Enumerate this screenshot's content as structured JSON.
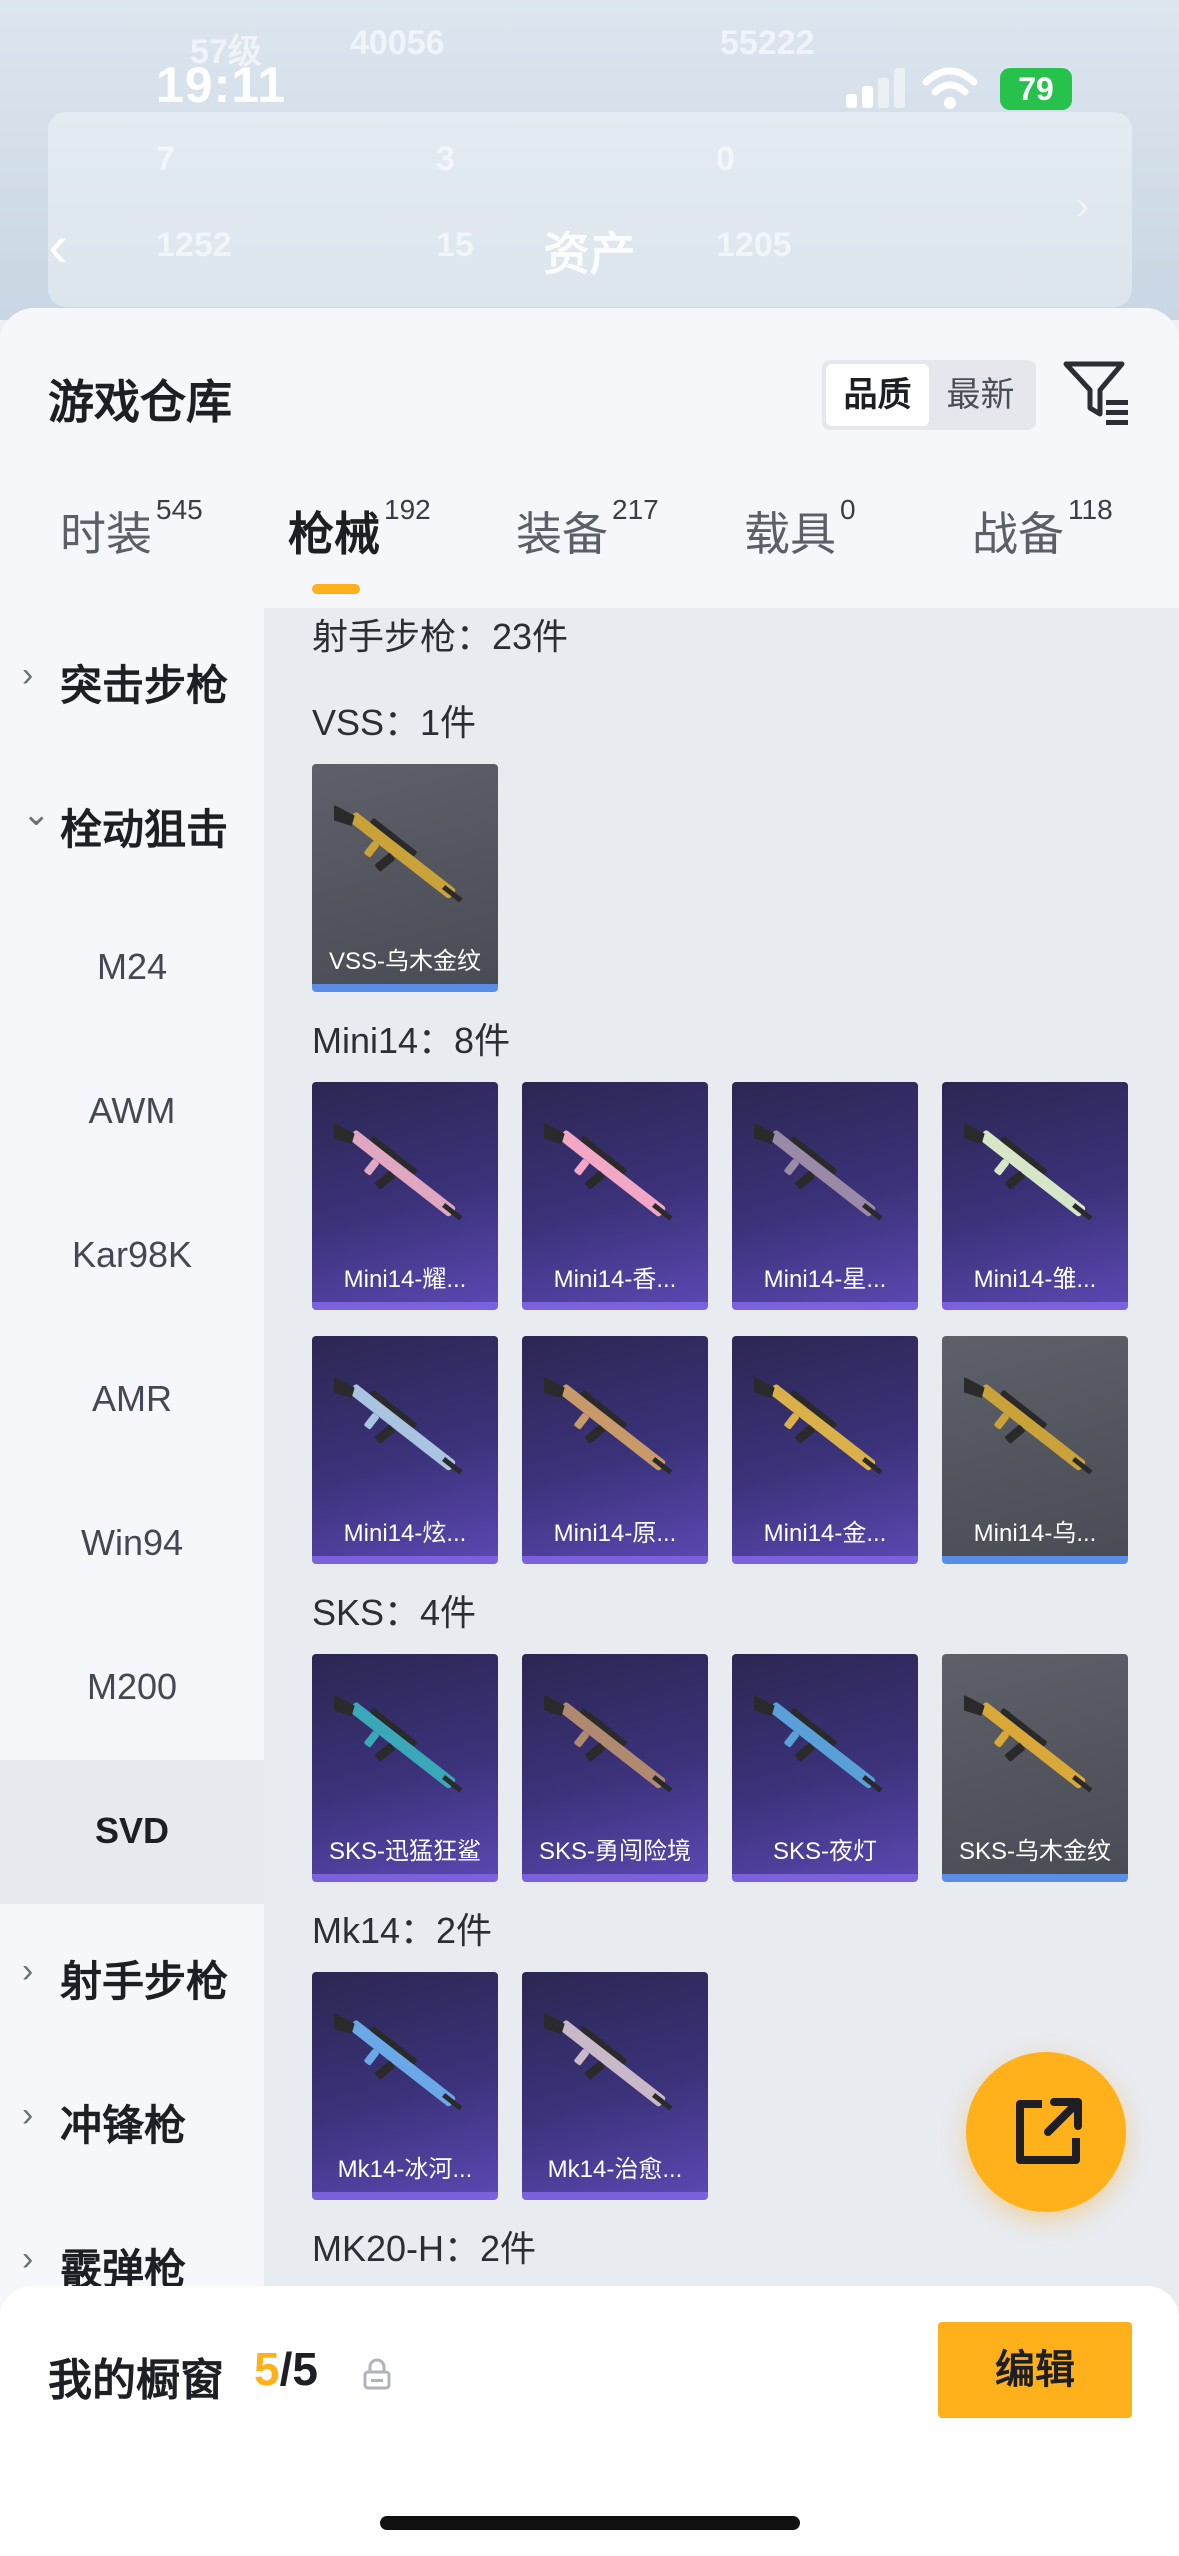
{
  "status": {
    "time": "19:11",
    "battery": "79"
  },
  "background": {
    "nav_title": "资产",
    "level": "57级",
    "views": "40056",
    "score": "55222",
    "stats": [
      "7",
      "3",
      "0",
      "1252",
      "15",
      "1205"
    ]
  },
  "header": {
    "title": "游戏仓库",
    "sort_options": [
      "品质",
      "最新"
    ],
    "active_sort": "品质"
  },
  "tabs": [
    {
      "label": "时装",
      "count": "545"
    },
    {
      "label": "枪械",
      "count": "192",
      "active": true
    },
    {
      "label": "装备",
      "count": "217"
    },
    {
      "label": "载具",
      "count": "0"
    },
    {
      "label": "战备",
      "count": "118"
    }
  ],
  "sidebar": [
    {
      "label": "突击步枪",
      "type": "category"
    },
    {
      "label": "栓动狙击",
      "type": "category",
      "expanded": true
    },
    {
      "label": "M24",
      "type": "sub"
    },
    {
      "label": "AWM",
      "type": "sub"
    },
    {
      "label": "Kar98K",
      "type": "sub"
    },
    {
      "label": "AMR",
      "type": "sub"
    },
    {
      "label": "Win94",
      "type": "sub"
    },
    {
      "label": "M200",
      "type": "sub"
    },
    {
      "label": "SVD",
      "type": "sub",
      "selected": true
    },
    {
      "label": "射手步枪",
      "type": "category"
    },
    {
      "label": "冲锋枪",
      "type": "category"
    },
    {
      "label": "霰弹枪",
      "type": "category"
    }
  ],
  "content": {
    "section_header": "射手步枪：23件",
    "groups": [
      {
        "title": "VSS：1件",
        "items": [
          {
            "name": "VSS-乌木金纹",
            "rarity": "dark",
            "gun_color": "#c9a23a"
          }
        ]
      },
      {
        "title": "Mini14：8件",
        "items": [
          {
            "name": "Mini14-耀...",
            "rarity": "purple",
            "gun_color": "#e0a7c0"
          },
          {
            "name": "Mini14-香...",
            "rarity": "purple",
            "gun_color": "#f2a7c4"
          },
          {
            "name": "Mini14-星...",
            "rarity": "purple",
            "gun_color": "#9a8aa8"
          },
          {
            "name": "Mini14-雏...",
            "rarity": "purple",
            "gun_color": "#d8e6c8"
          },
          {
            "name": "Mini14-炫...",
            "rarity": "purple",
            "gun_color": "#a9c4e0"
          },
          {
            "name": "Mini14-原...",
            "rarity": "purple",
            "gun_color": "#c89a6a"
          },
          {
            "name": "Mini14-金...",
            "rarity": "purple",
            "gun_color": "#d9b04a"
          },
          {
            "name": "Mini14-乌...",
            "rarity": "dark",
            "gun_color": "#c9a23a"
          }
        ]
      },
      {
        "title": "SKS：4件",
        "items": [
          {
            "name": "SKS-迅猛狂鲨",
            "rarity": "purple",
            "gun_color": "#3aa8b8"
          },
          {
            "name": "SKS-勇闯险境",
            "rarity": "purple",
            "gun_color": "#b08a70"
          },
          {
            "name": "SKS-夜灯",
            "rarity": "purple",
            "gun_color": "#5aa0d8"
          },
          {
            "name": "SKS-乌木金纹",
            "rarity": "dark",
            "gun_color": "#d9a838"
          }
        ]
      },
      {
        "title": "Mk14：2件",
        "items": [
          {
            "name": "Mk14-冰河...",
            "rarity": "purple",
            "gun_color": "#6aa8e8"
          },
          {
            "name": "Mk14-治愈...",
            "rarity": "purple",
            "gun_color": "#c8b8c8"
          }
        ]
      },
      {
        "title": "MK20-H：2件",
        "items": []
      }
    ]
  },
  "showcase": {
    "label": "我的橱窗",
    "current": "5",
    "total": "/5",
    "edit_label": "编辑"
  },
  "colors": {
    "accent": "#ffb11b",
    "purple_card": "#3b327a",
    "dark_card": "#4a4c55"
  }
}
